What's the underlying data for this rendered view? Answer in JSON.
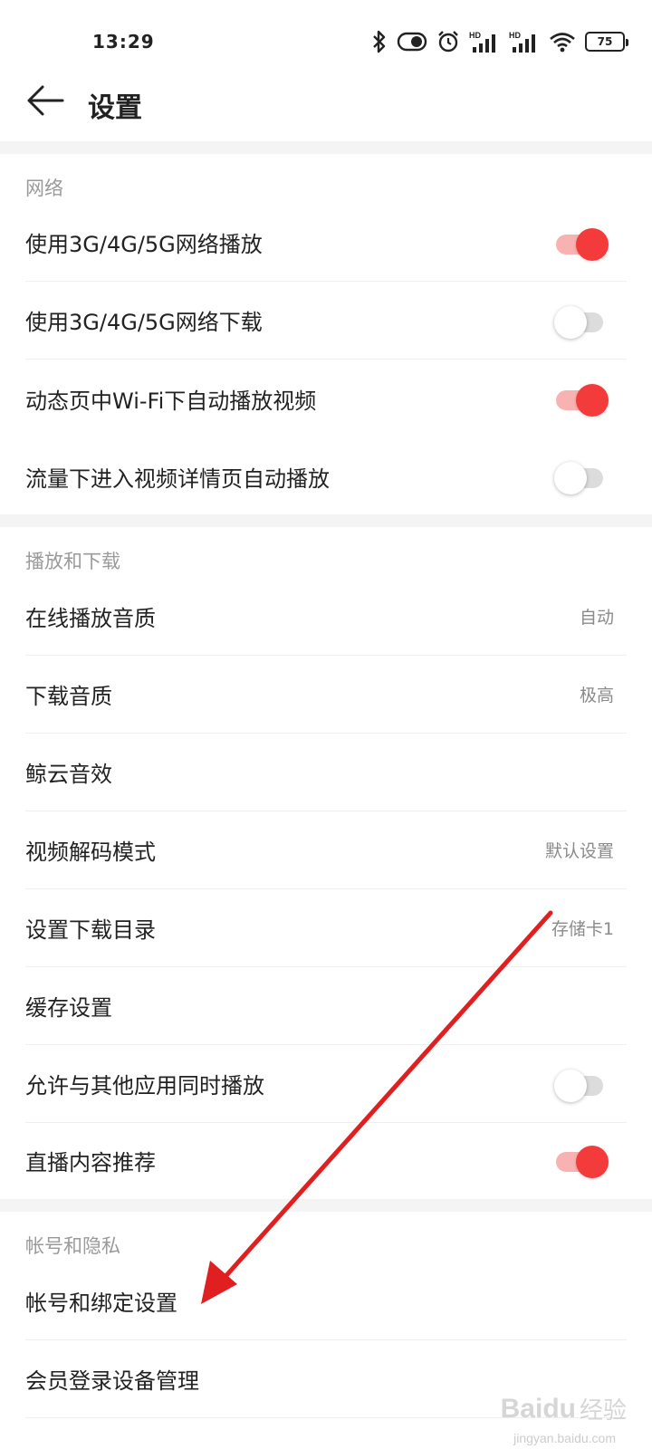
{
  "status_bar": {
    "time": "13:29",
    "battery": "75",
    "icons": [
      "bluetooth-icon",
      "toggle-status-icon",
      "alarm-icon",
      "signal-hd-icon",
      "signal-hd-icon",
      "wifi-icon",
      "battery-icon"
    ],
    "hd_label": "HD"
  },
  "header": {
    "title": "设置",
    "back_icon": "back-arrow-icon"
  },
  "sections": {
    "network": {
      "title": "网络",
      "items": [
        {
          "label": "使用3G/4G/5G网络播放",
          "toggle": true
        },
        {
          "label": "使用3G/4G/5G网络下载",
          "toggle": false
        },
        {
          "label": "动态页中Wi-Fi下自动播放视频",
          "toggle": true
        },
        {
          "label": "流量下进入视频详情页自动播放",
          "toggle": false
        }
      ]
    },
    "playback": {
      "title": "播放和下载",
      "items": [
        {
          "label": "在线播放音质",
          "value": "自动"
        },
        {
          "label": "下载音质",
          "value": "极高"
        },
        {
          "label": "鲸云音效",
          "value": ""
        },
        {
          "label": "视频解码模式",
          "value": "默认设置"
        },
        {
          "label": "设置下载目录",
          "value": "存储卡1"
        },
        {
          "label": "缓存设置",
          "value": ""
        },
        {
          "label": "允许与其他应用同时播放",
          "toggle": false
        },
        {
          "label": "直播内容推荐",
          "toggle": true
        }
      ]
    },
    "account": {
      "title": "帐号和隐私",
      "items": [
        {
          "label": "帐号和绑定设置"
        },
        {
          "label": "会员登录设备管理"
        }
      ]
    }
  },
  "colors": {
    "accent": "#f33b3b",
    "accent_track": "#f8b2b2",
    "annotation_arrow": "#e02020",
    "section_gap": "#f4f4f4"
  },
  "watermark": {
    "text": "Baidu",
    "sub": "经验",
    "url": "jingyan.baidu.com"
  }
}
